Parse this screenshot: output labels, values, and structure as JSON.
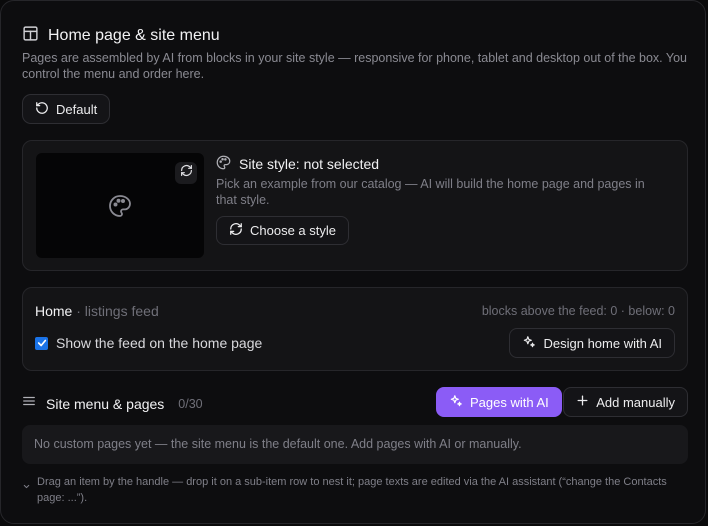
{
  "header": {
    "title": "Home page & site menu",
    "description": "Pages are assembled by AI from blocks in your site style — responsive for phone, tablet and desktop out of the box. You control the menu and order here."
  },
  "default_button": {
    "label": "Default"
  },
  "site_style": {
    "title": "Site style: not selected",
    "description": "Pick an example from our catalog — AI will build the home page and pages in that style.",
    "choose_label": "Choose a style"
  },
  "feed": {
    "title": "Home",
    "subtitle": "· listings feed",
    "blocks_info": "blocks above the feed: 0 · below: 0",
    "checkbox_label": "Show the feed on the home page",
    "checkbox_checked": true,
    "design_label": "Design home with AI"
  },
  "menu": {
    "title": "Site menu & pages",
    "count": "0/30",
    "pages_ai_label": "Pages with AI",
    "add_manually_label": "Add manually",
    "empty_text": "No custom pages yet — the site menu is the default one. Add pages with AI or manually.",
    "hint": "Drag an item by the handle — drop it on a sub-item row to nest it; page texts are edited via the AI assistant (“change the Contacts page: ...”)."
  },
  "colors": {
    "accent": "#8b5cf6",
    "checkbox": "#1a73e8"
  }
}
